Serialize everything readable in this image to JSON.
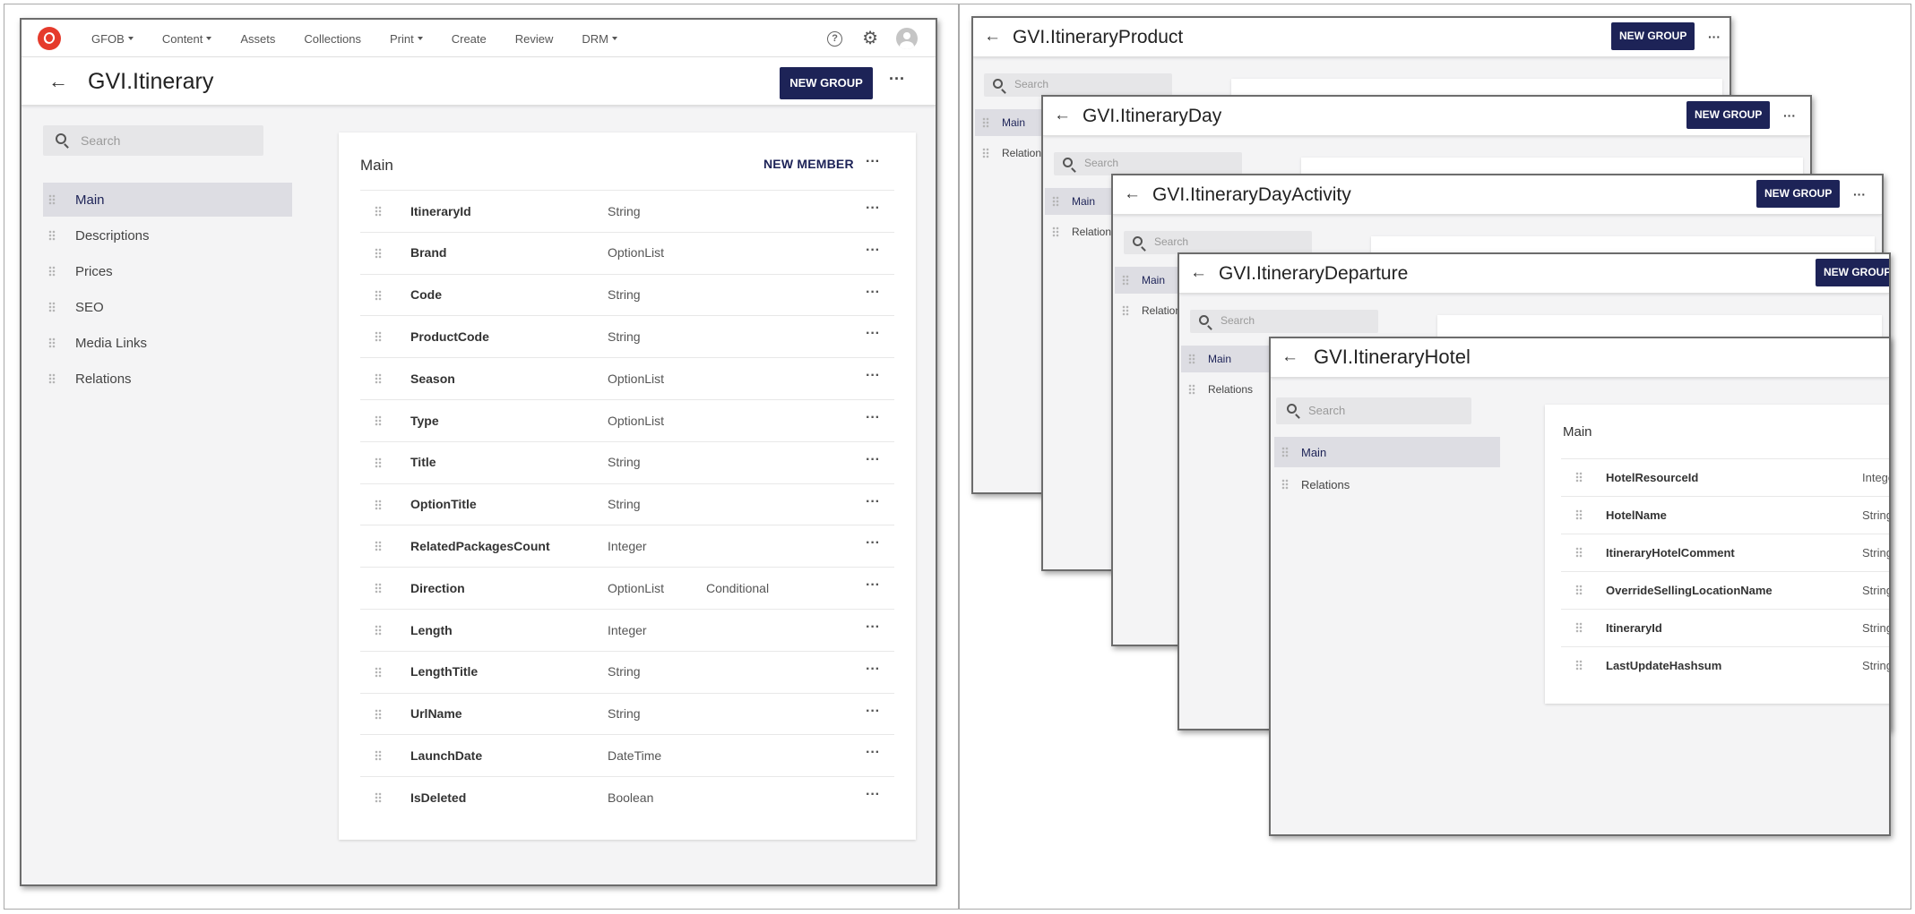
{
  "main": {
    "nav": {
      "items": [
        "GFOB",
        "Content",
        "Assets",
        "Collections",
        "Print",
        "Create",
        "Review",
        "DRM"
      ],
      "has_caret": [
        true,
        true,
        false,
        false,
        true,
        false,
        false,
        true
      ]
    },
    "title": "GVI.Itinerary",
    "new_group": "NEW GROUP",
    "search_placeholder": "Search",
    "sidebar": [
      "Main",
      "Descriptions",
      "Prices",
      "SEO",
      "Media Links",
      "Relations"
    ],
    "panel_title": "Main",
    "new_member": "NEW MEMBER",
    "fields": [
      {
        "name": "ItineraryId",
        "type": "String",
        "cond": ""
      },
      {
        "name": "Brand",
        "type": "OptionList",
        "cond": ""
      },
      {
        "name": "Code",
        "type": "String",
        "cond": ""
      },
      {
        "name": "ProductCode",
        "type": "String",
        "cond": ""
      },
      {
        "name": "Season",
        "type": "OptionList",
        "cond": ""
      },
      {
        "name": "Type",
        "type": "OptionList",
        "cond": ""
      },
      {
        "name": "Title",
        "type": "String",
        "cond": ""
      },
      {
        "name": "OptionTitle",
        "type": "String",
        "cond": ""
      },
      {
        "name": "RelatedPackagesCount",
        "type": "Integer",
        "cond": ""
      },
      {
        "name": "Direction",
        "type": "OptionList",
        "cond": "Conditional"
      },
      {
        "name": "Length",
        "type": "Integer",
        "cond": ""
      },
      {
        "name": "LengthTitle",
        "type": "String",
        "cond": ""
      },
      {
        "name": "UrlName",
        "type": "String",
        "cond": ""
      },
      {
        "name": "LaunchDate",
        "type": "DateTime",
        "cond": ""
      },
      {
        "name": "IsDeleted",
        "type": "Boolean",
        "cond": ""
      }
    ]
  },
  "stack": [
    {
      "title": "GVI.ItineraryProduct",
      "sidebar": [
        "Main",
        "Relations"
      ],
      "new_group": "NEW GROUP"
    },
    {
      "title": "GVI.ItineraryDay",
      "sidebar": [
        "Main",
        "Relations"
      ],
      "new_group": "NEW GROUP"
    },
    {
      "title": "GVI.ItineraryDayActivity",
      "sidebar": [
        "Main",
        "Relations"
      ],
      "new_group": "NEW GROUP"
    },
    {
      "title": "GVI.ItineraryDeparture",
      "sidebar": [
        "Main",
        "Relations"
      ],
      "new_group": "NEW GROUP"
    }
  ],
  "hotel": {
    "title": "GVI.ItineraryHotel",
    "sidebar": [
      "Main",
      "Relations"
    ],
    "search_placeholder": "Search",
    "panel_title": "Main",
    "fields": [
      {
        "name": "HotelResourceId",
        "type": "Integer"
      },
      {
        "name": "HotelName",
        "type": "String"
      },
      {
        "name": "ItineraryHotelComment",
        "type": "String"
      },
      {
        "name": "OverrideSellingLocationName",
        "type": "String"
      },
      {
        "name": "ItineraryId",
        "type": "String"
      },
      {
        "name": "LastUpdateHashsum",
        "type": "String"
      }
    ]
  },
  "colors": {
    "accent": "#1d2357",
    "brand": "#e53b2c",
    "background": "#f4f4f5"
  }
}
